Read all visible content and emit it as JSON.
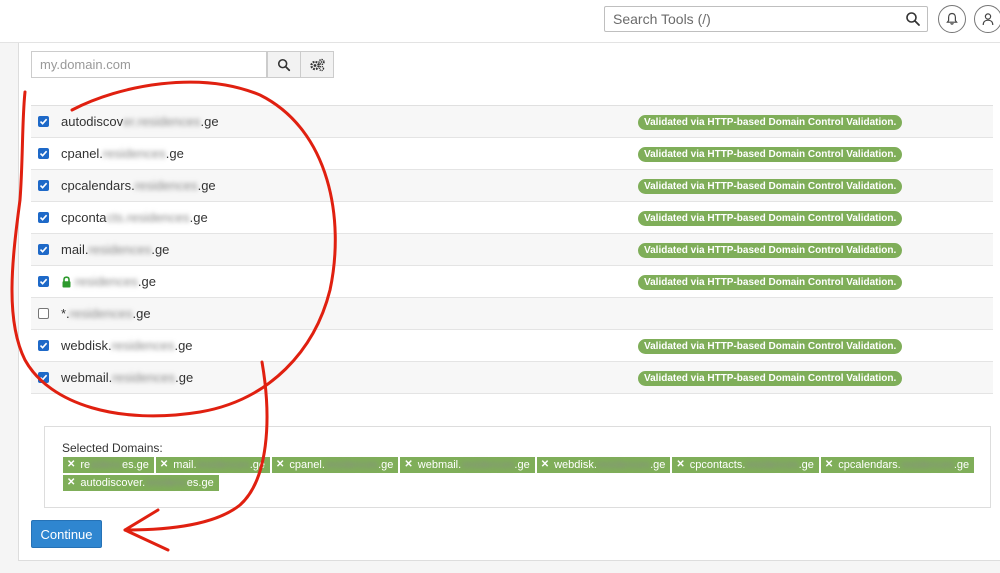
{
  "header": {
    "search_placeholder": "Search Tools (/)"
  },
  "domain_search": {
    "placeholder": "my.domain.com"
  },
  "domains": [
    {
      "prefix": "autodiscov",
      "hidden": "er.residences",
      "suffix": ".ge",
      "checked": true,
      "lock": false,
      "status": "Validated via HTTP-based Domain Control Validation."
    },
    {
      "prefix": "cpanel.",
      "hidden": "residences",
      "suffix": ".ge",
      "checked": true,
      "lock": false,
      "status": "Validated via HTTP-based Domain Control Validation."
    },
    {
      "prefix": "cpcalendars.",
      "hidden": "residences",
      "suffix": ".ge",
      "checked": true,
      "lock": false,
      "status": "Validated via HTTP-based Domain Control Validation."
    },
    {
      "prefix": "cpconta",
      "hidden": "cts.residences",
      "suffix": ".ge",
      "checked": true,
      "lock": false,
      "status": "Validated via HTTP-based Domain Control Validation."
    },
    {
      "prefix": "mail.",
      "hidden": "residences",
      "suffix": ".ge",
      "checked": true,
      "lock": false,
      "status": "Validated via HTTP-based Domain Control Validation."
    },
    {
      "prefix": "",
      "hidden": "residences",
      "suffix": ".ge",
      "checked": true,
      "lock": true,
      "status": "Validated via HTTP-based Domain Control Validation."
    },
    {
      "prefix": "*.",
      "hidden": "residences",
      "suffix": ".ge",
      "checked": false,
      "lock": false,
      "status": ""
    },
    {
      "prefix": "webdisk.",
      "hidden": "residences",
      "suffix": ".ge",
      "checked": true,
      "lock": false,
      "status": "Validated via HTTP-based Domain Control Validation."
    },
    {
      "prefix": "webmail.",
      "hidden": "residences",
      "suffix": ".ge",
      "checked": true,
      "lock": false,
      "status": "Validated via HTTP-based Domain Control Validation."
    }
  ],
  "selected": {
    "label": "Selected Domains:",
    "tags": [
      {
        "prefix": "re",
        "hidden": "sidenc",
        "suffix": "es.ge"
      },
      {
        "prefix": "mail.",
        "hidden": "residences",
        "suffix": ".ge"
      },
      {
        "prefix": "cpanel.",
        "hidden": "residences",
        "suffix": ".ge"
      },
      {
        "prefix": "webmail.",
        "hidden": "residences",
        "suffix": ".ge"
      },
      {
        "prefix": "webdisk.",
        "hidden": "residences",
        "suffix": ".ge"
      },
      {
        "prefix": "cpcontacts.",
        "hidden": "residences",
        "suffix": ".ge"
      },
      {
        "prefix": "cpcalendars.",
        "hidden": "residences",
        "suffix": ".ge"
      },
      {
        "prefix": "autodiscover.",
        "hidden": "residenc",
        "suffix": "es.ge"
      }
    ]
  },
  "actions": {
    "continue_label": "Continue"
  },
  "colors": {
    "badge": "#7fae59",
    "primary": "#2f86d0",
    "checkbox": "#1e69c8",
    "annotation": "#e02010"
  }
}
